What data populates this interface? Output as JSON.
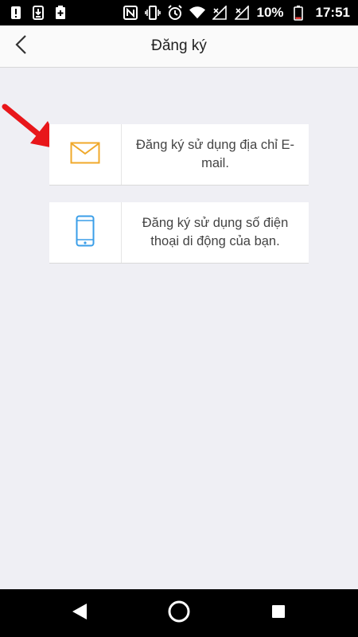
{
  "status_bar": {
    "battery_percent": "10%",
    "time": "17:51",
    "icons": [
      "alert-icon",
      "download-icon",
      "battery-plus-icon",
      "nfc-icon",
      "vibrate-icon",
      "alarm-icon",
      "wifi-icon",
      "signal-icon",
      "signal-icon-2",
      "battery-icon"
    ]
  },
  "header": {
    "title": "Đăng ký",
    "back_icon": "chevron-left-icon"
  },
  "options": [
    {
      "label": "Đăng ký sử dụng địa chỉ E-mail.",
      "icon": "envelope-icon",
      "icon_color": "#f0a92b"
    },
    {
      "label": "Đăng ký sử dụng số điện thoại di động của bạn.",
      "icon": "phone-icon",
      "icon_color": "#3a9ee8"
    }
  ],
  "annotation": {
    "color": "#e8161a",
    "icon": "red-arrow"
  },
  "nav_bar": {
    "back_icon": "triangle-back-icon",
    "home_icon": "circle-home-icon",
    "recents_icon": "square-recents-icon"
  }
}
